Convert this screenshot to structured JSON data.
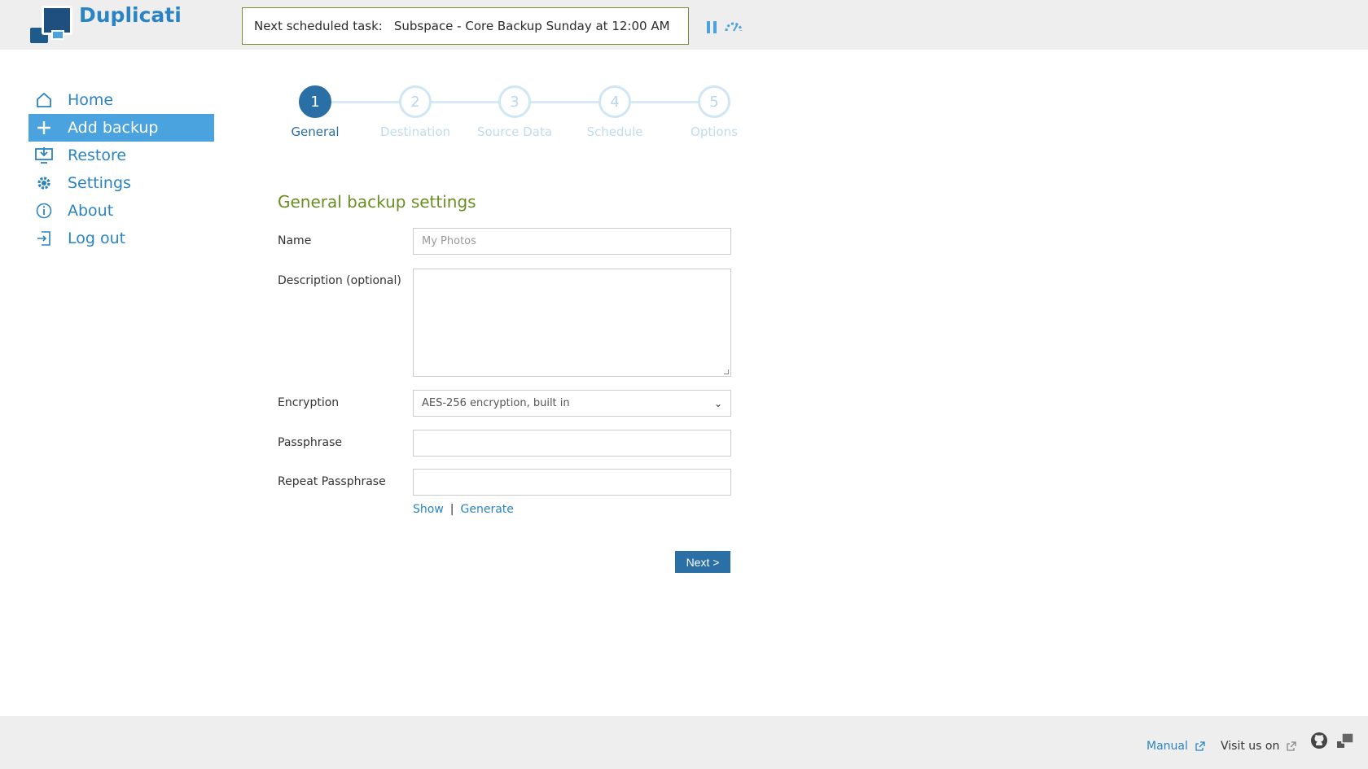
{
  "app": {
    "title": "Duplicati"
  },
  "header": {
    "task_label": "Next scheduled task:",
    "task_value": "Subspace - Core Backup Sunday at 12:00 AM",
    "icons": [
      "pause-icon",
      "throttle-icon"
    ]
  },
  "sidebar": {
    "items": [
      {
        "label": "Home",
        "icon": "home-icon",
        "active": false
      },
      {
        "label": "Add backup",
        "icon": "plus-icon",
        "active": true
      },
      {
        "label": "Restore",
        "icon": "restore-icon",
        "active": false
      },
      {
        "label": "Settings",
        "icon": "gear-icon",
        "active": false
      },
      {
        "label": "About",
        "icon": "info-icon",
        "active": false
      },
      {
        "label": "Log out",
        "icon": "logout-icon",
        "active": false
      }
    ]
  },
  "stepper": {
    "steps": [
      {
        "number": "1",
        "label": "General",
        "active": true
      },
      {
        "number": "2",
        "label": "Destination",
        "active": false
      },
      {
        "number": "3",
        "label": "Source Data",
        "active": false
      },
      {
        "number": "4",
        "label": "Schedule",
        "active": false
      },
      {
        "number": "5",
        "label": "Options",
        "active": false
      }
    ]
  },
  "form": {
    "title": "General backup settings",
    "name_label": "Name",
    "name_placeholder": "My Photos",
    "description_label": "Description (optional)",
    "encryption_label": "Encryption",
    "encryption_value": "AES-256 encryption, built in",
    "passphrase_label": "Passphrase",
    "repeat_passphrase_label": "Repeat Passphrase",
    "show_link": "Show",
    "separator": "|",
    "generate_link": "Generate",
    "next_button": "Next >"
  },
  "footer": {
    "manual": "Manual",
    "visit": "Visit us on"
  },
  "colors": {
    "accent": "#4aa3df",
    "brand": "#2a84c4",
    "step_active": "#2a6fa6",
    "title_green": "#6b8e23"
  }
}
